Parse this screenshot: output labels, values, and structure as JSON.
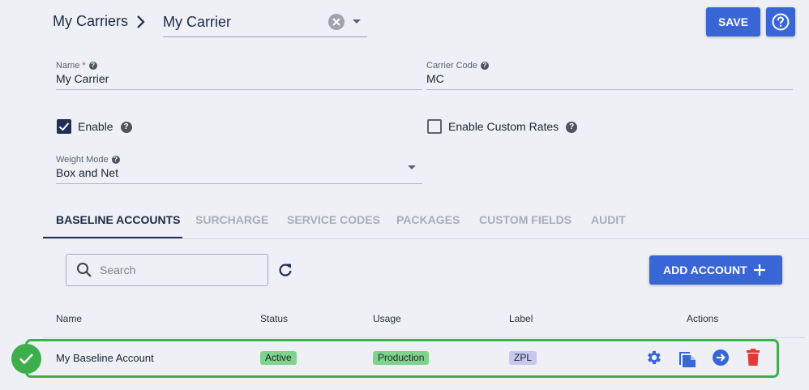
{
  "header": {
    "breadcrumb_parent": "My Carriers",
    "carrier_selected": "My Carrier",
    "save_label": "SAVE"
  },
  "form": {
    "name_label": "Name",
    "name_required": "*",
    "name_value": "My Carrier",
    "code_label": "Carrier Code",
    "code_value": "MC",
    "enable_label": "Enable",
    "enable_checked": true,
    "custom_rates_label": "Enable Custom Rates",
    "custom_rates_checked": false,
    "weight_mode_label": "Weight Mode",
    "weight_mode_value": "Box and Net"
  },
  "tabs": [
    {
      "label": "BASELINE ACCOUNTS",
      "active": true
    },
    {
      "label": "SURCHARGE",
      "active": false
    },
    {
      "label": "SERVICE CODES",
      "active": false
    },
    {
      "label": "PACKAGES",
      "active": false
    },
    {
      "label": "CUSTOM FIELDS",
      "active": false
    },
    {
      "label": "AUDIT",
      "active": false
    }
  ],
  "toolbar": {
    "search_placeholder": "Search",
    "add_account_label": "ADD ACCOUNT"
  },
  "table": {
    "columns": [
      "Name",
      "Status",
      "Usage",
      "Label",
      "Actions"
    ],
    "rows": [
      {
        "name": "My Baseline Account",
        "status": "Active",
        "usage": "Production",
        "label": "ZPL"
      }
    ]
  },
  "colors": {
    "primary": "#3866d6",
    "success": "#3cae4b",
    "delete": "#e53935"
  },
  "icons": [
    "chevron-right-icon",
    "clear-icon",
    "help-icon",
    "search-icon",
    "refresh-icon",
    "plus-icon",
    "check-icon",
    "settings-icon",
    "copy-icon",
    "arrow-right-circle-icon",
    "delete-icon"
  ]
}
